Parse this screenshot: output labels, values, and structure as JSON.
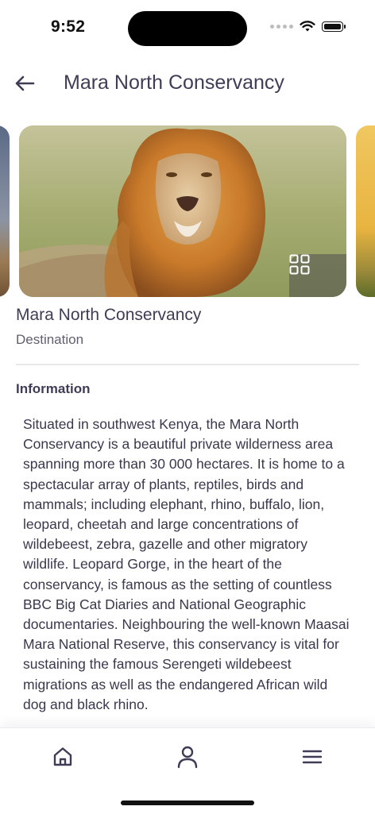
{
  "status": {
    "time": "9:52"
  },
  "header": {
    "title": "Mara North Conservancy"
  },
  "place": {
    "name": "Mara North Conservancy",
    "type": "Destination"
  },
  "info": {
    "heading": "Information",
    "body": "Situated in southwest Kenya, the Mara North Conservancy is a beautiful private wilderness area spanning more than 30 000 hectares. It is home to a spectacular array of plants, reptiles, birds and mammals; including elephant, rhino, buffalo, lion, leopard, cheetah and large concentrations of wildebeest, zebra, gazelle and other migratory wildlife. Leopard Gorge, in the heart of the conservancy, is famous as the setting of countless BBC Big Cat Diaries and National Geographic documentaries. Neighbouring the well-known Maasai Mara National Reserve, this conservancy is vital for sustaining the famous Serengeti wildebeest migrations as well as the endangered African wild dog and black rhino."
  },
  "icons": {
    "back": "arrow-left-icon",
    "gallery": "grid-icon",
    "home": "home-icon",
    "profile": "user-icon",
    "menu": "menu-icon"
  },
  "colors": {
    "text": "#3f3d56",
    "accent": "#3f3d56"
  }
}
